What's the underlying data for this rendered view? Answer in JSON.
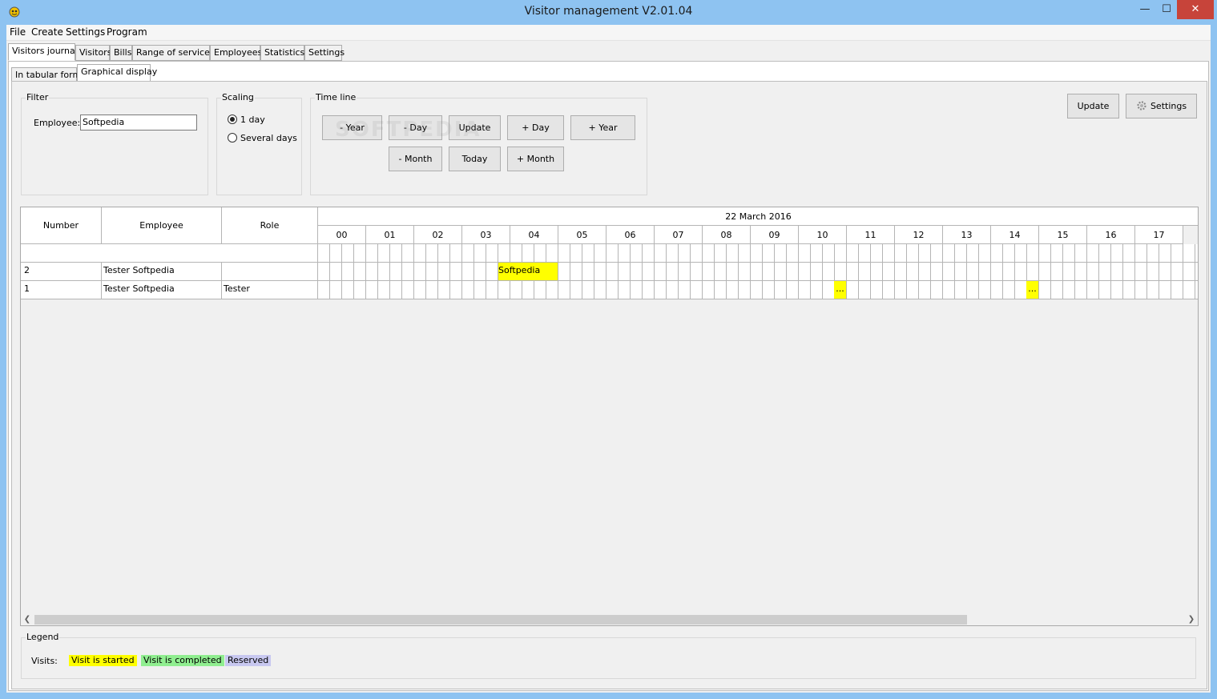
{
  "window": {
    "title": "Visitor management V2.01.04",
    "controls": {
      "minimize": "—",
      "maximize": "☐",
      "close": "✕"
    }
  },
  "menu": [
    "File",
    "Create",
    "Settings",
    "Program"
  ],
  "main_tabs": [
    "Visitors journal",
    "Visitors",
    "Bills",
    "Range of services",
    "Employees",
    "Statistics",
    "Settings"
  ],
  "sub_tabs": [
    "In tabular form",
    "Graphical display"
  ],
  "filter": {
    "title": "Filter",
    "employee_label": "Employee:",
    "employee_value": "Softpedia"
  },
  "scaling": {
    "title": "Scaling",
    "option_1": "1 day",
    "option_2": "Several days",
    "selected": "1 day"
  },
  "timeline": {
    "title": "Time line",
    "minus_year": "- Year",
    "minus_day": "- Day",
    "update": "Update",
    "plus_day": "+ Day",
    "plus_year": "+ Year",
    "minus_month": "- Month",
    "today": "Today",
    "plus_month": "+ Month"
  },
  "toolbar": {
    "update": "Update",
    "settings": "Settings"
  },
  "grid": {
    "headers": {
      "number": "Number",
      "employee": "Employee",
      "role": "Role"
    },
    "date": "22 March 2016",
    "hours": [
      "00",
      "01",
      "02",
      "03",
      "04",
      "05",
      "06",
      "07",
      "08",
      "09",
      "10",
      "11",
      "12",
      "13",
      "14",
      "15",
      "16",
      "17"
    ],
    "rows": [
      {
        "number": "2",
        "employee": "Tester Softpedia",
        "role": ""
      },
      {
        "number": "1",
        "employee": "Tester Softpedia",
        "role": "Tester"
      }
    ],
    "visits": {
      "v1": "Softpedia",
      "v2": "...",
      "v3": "..."
    }
  },
  "legend": {
    "title": "Legend",
    "visits_label": "Visits:",
    "started": "Visit is started",
    "completed": "Visit is completed",
    "reserved": "Reserved",
    "colors": {
      "started": "#ffff00",
      "completed": "#90ee90",
      "reserved": "#c8c8f0"
    }
  },
  "watermark": "SOFTPEDIA"
}
